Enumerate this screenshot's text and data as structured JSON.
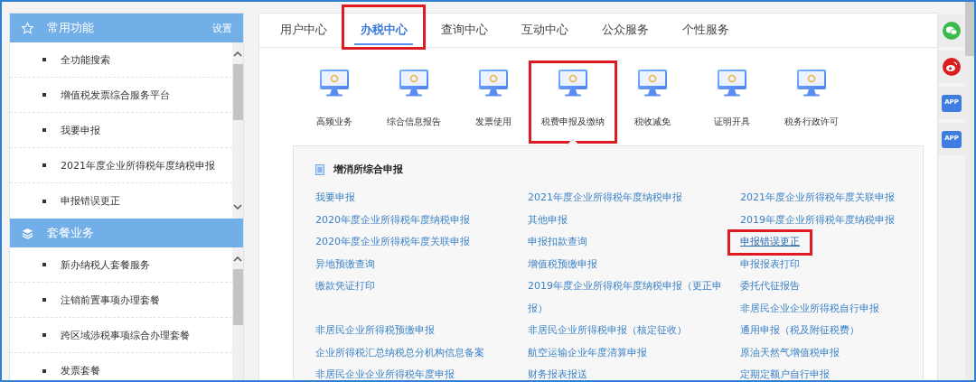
{
  "sidebar": {
    "sections": [
      {
        "kind": "favorites",
        "title": "常用功能",
        "action": "设置",
        "items": [
          "全功能搜索",
          "增值税发票综合服务平台",
          "我要申报",
          "2021年度企业所得税年度纳税申报",
          "申报错误更正"
        ]
      },
      {
        "kind": "packages",
        "title": "套餐业务",
        "items": [
          "新办纳税人套餐服务",
          "注销前置事项办理套餐",
          "跨区域涉税事项综合办理套餐",
          "发票套餐"
        ]
      }
    ]
  },
  "tabs": [
    {
      "label": "用户中心",
      "selected": false,
      "highlighted": false
    },
    {
      "label": "办税中心",
      "selected": true,
      "highlighted": true
    },
    {
      "label": "查询中心",
      "selected": false,
      "highlighted": false
    },
    {
      "label": "互动中心",
      "selected": false,
      "highlighted": false
    },
    {
      "label": "公众服务",
      "selected": false,
      "highlighted": false
    },
    {
      "label": "个性服务",
      "selected": false,
      "highlighted": false
    }
  ],
  "categories": [
    {
      "label": "高频业务",
      "highlighted": false
    },
    {
      "label": "综合信息报告",
      "highlighted": false
    },
    {
      "label": "发票使用",
      "highlighted": false
    },
    {
      "label": "税费申报及缴纳",
      "highlighted": true
    },
    {
      "label": "税收减免",
      "highlighted": false
    },
    {
      "label": "证明开具",
      "highlighted": false
    },
    {
      "label": "税务行政许可",
      "highlighted": false
    }
  ],
  "panel": {
    "title": "增消所综合申报",
    "rows": [
      [
        [
          {
            "text": "我要申报",
            "highlighted": false
          }
        ],
        [
          {
            "text": "2021年度企业所得税年度纳税申报",
            "highlighted": false
          }
        ],
        [
          {
            "text": "2021年度企业所得税年度关联申报",
            "highlighted": false
          }
        ]
      ],
      [
        [
          {
            "text": "2020年度企业所得税年度纳税申报",
            "highlighted": false
          }
        ],
        [
          {
            "text": "其他申报",
            "highlighted": false
          }
        ],
        [
          {
            "text": "2019年度企业所得税年度纳税申报",
            "highlighted": false
          }
        ]
      ],
      [
        [
          {
            "text": "2020年度企业所得税年度关联申报",
            "highlighted": false
          }
        ],
        [
          {
            "text": "申报扣款查询",
            "highlighted": false
          }
        ],
        [
          {
            "text": "申报错误更正",
            "highlighted": true
          }
        ]
      ],
      [
        [
          {
            "text": "异地预缴查询",
            "highlighted": false
          }
        ],
        [
          {
            "text": "增值税预缴申报",
            "highlighted": false
          }
        ],
        [
          {
            "text": "申报报表打印",
            "highlighted": false
          }
        ]
      ],
      [
        [
          {
            "text": "缴款凭证打印",
            "highlighted": false
          }
        ],
        [
          {
            "text": "2019年度企业所得税年度纳税申报（更正申报）",
            "highlighted": false
          }
        ],
        [
          {
            "text": "委托代征报告",
            "highlighted": false
          },
          {
            "text": "非居民企业企业所得税自行申报",
            "highlighted": false
          }
        ]
      ],
      [
        [
          {
            "text": "非居民企业所得税预缴申报",
            "highlighted": false
          }
        ],
        [
          {
            "text": "非居民企业所得税申报（核定征收）",
            "highlighted": false
          }
        ],
        [
          {
            "text": "通用申报（税及附征税费）",
            "highlighted": false
          }
        ]
      ],
      [
        [
          {
            "text": "企业所得税汇总纳税总分机构信息备案",
            "highlighted": false
          }
        ],
        [
          {
            "text": "航空运输企业年度清算申报",
            "highlighted": false
          }
        ],
        [
          {
            "text": "原油天然气增值税申报",
            "highlighted": false
          }
        ]
      ],
      [
        [
          {
            "text": "非居民企业企业所得税年度申报",
            "highlighted": false
          }
        ],
        [
          {
            "text": "财务报表报送",
            "highlighted": false
          }
        ],
        [
          {
            "text": "定期定额户自行申报",
            "highlighted": false
          }
        ]
      ]
    ]
  },
  "side_links": [
    {
      "kind": "wechat"
    },
    {
      "kind": "weibo"
    },
    {
      "kind": "app",
      "label": "APP"
    },
    {
      "kind": "app",
      "label": "APP"
    }
  ]
}
